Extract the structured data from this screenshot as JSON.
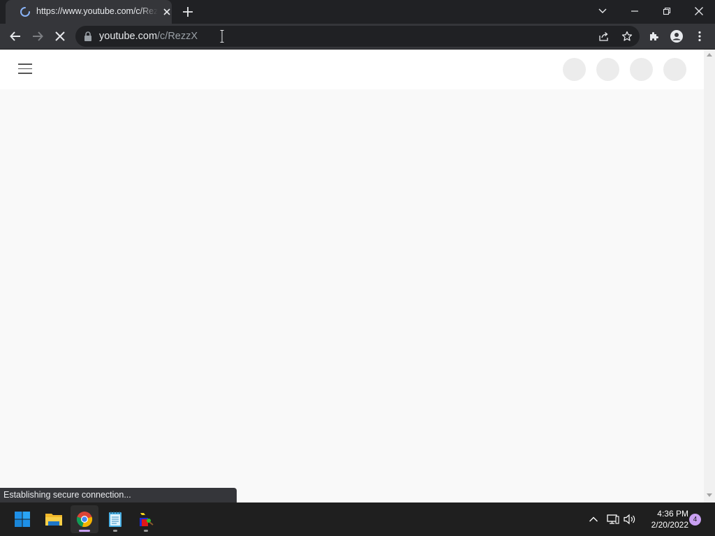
{
  "browser": {
    "tab": {
      "title": "https://www.youtube.com/c/RezzX",
      "state": "loading"
    },
    "omnibox": {
      "url_host": "youtube.com",
      "url_path": "/c/RezzX"
    },
    "status_text": "Establishing secure connection..."
  },
  "taskbar": {
    "apps": [
      "start-button",
      "file-explorer",
      "google-chrome",
      "notepad",
      "paint"
    ],
    "clock": {
      "time": "4:36 PM",
      "date": "2/20/2022"
    },
    "notification_count": "4"
  },
  "colors": {
    "titlebar": "#202124",
    "toolbar": "#35363a",
    "page_bg": "#f9f9f9",
    "taskbar": "#1f1f1f"
  }
}
